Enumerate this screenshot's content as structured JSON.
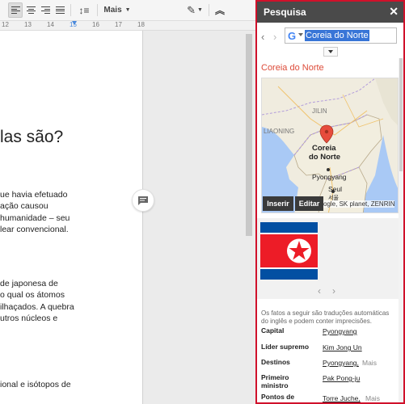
{
  "toolbar": {
    "more_label": "Mais"
  },
  "ruler": {
    "ticks": [
      "12",
      "13",
      "14",
      "15",
      "16",
      "17",
      "18"
    ]
  },
  "document": {
    "heading": "las são?",
    "paragraph1": [
      "ue havia efetuado",
      "ação causou",
      "humanidade – seu",
      "lear convencional."
    ],
    "paragraph2": [
      "de japonesa de",
      "o qual os átomos",
      "ilhaçados. A quebra",
      "utros núcleos e"
    ],
    "paragraph3": [
      "ional e isótopos de"
    ]
  },
  "panel": {
    "title": "Pesquisa",
    "close": "✕",
    "search_value": "Coreia do Norte",
    "result_title": "Coreia do Norte",
    "map": {
      "labels": {
        "jilin": "JILIN",
        "liaoning": "LIAONING",
        "country_line1": "Coreia",
        "country_line2": "do Norte",
        "pyongyang": "Pyongyang",
        "seul": "Seul",
        "seul_korean": "서울"
      },
      "insert_label": "Inserir",
      "edit_label": "Editar",
      "credit": "ogle, SK planet, ZENRIN"
    },
    "note": "Os fatos a seguir são traduções automáticas do inglês e podem conter imprecisões.",
    "facts": [
      {
        "label": "Capital",
        "value": "Pyongyang",
        "more": ""
      },
      {
        "label": "Líder supremo",
        "value": "Kim Jong Un",
        "more": ""
      },
      {
        "label": "Destinos",
        "value": "Pyongyang,",
        "more": "Mais"
      },
      {
        "label": "Primeiro ministro",
        "value": "Pak Pong-ju",
        "more": ""
      },
      {
        "label": "Pontos de",
        "value": "Torre Juche,",
        "more": "Mais"
      }
    ]
  },
  "colors": {
    "panel_border": "#d0112b",
    "header_bg": "#4a4a4a",
    "result_title": "#dd4b39",
    "selection": "#3875d7",
    "flag_blue": "#024fa2",
    "flag_red": "#ed1c27"
  }
}
